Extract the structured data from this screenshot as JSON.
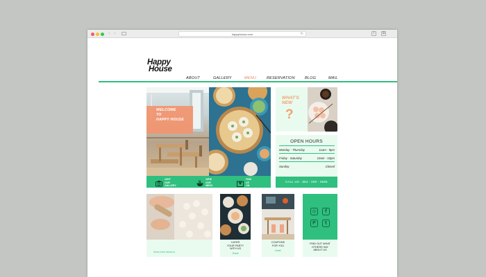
{
  "browser": {
    "url": "happyhouse.com",
    "back_icon": "back-arrow-icon",
    "forward_icon": "forward-arrow-icon",
    "reload_icon": "reload-icon",
    "back_glyph": "‹",
    "forward_glyph": "›",
    "reload_glyph": "↻",
    "share_glyph": "⇧",
    "tabs_glyph": "⧉"
  },
  "site": {
    "logo_line1": "Happy",
    "logo_line2": "House"
  },
  "nav": {
    "items": [
      {
        "label": "ABOUT"
      },
      {
        "label": "GALLERY"
      },
      {
        "label": "MENU",
        "active": true
      },
      {
        "label": "RESERVATION"
      },
      {
        "label": "BLOG"
      },
      {
        "label": "MAIL"
      }
    ]
  },
  "hero": {
    "welcome_line1": "WELCOME",
    "welcome_line2": "TO",
    "welcome_line3": "HAPPY HOUSE",
    "actions": [
      {
        "label": "VISIT OUR\nGALLERY",
        "icon": "camera-icon"
      },
      {
        "label": "VIEW OUR\nMENU",
        "icon": "bowl-icon"
      },
      {
        "label": "FIND US ON\nTHE MAP",
        "icon": "map-pin-icon"
      }
    ]
  },
  "news": {
    "title_line1": "WHAT'S",
    "title_line2": "NEW",
    "mark": "?"
  },
  "hours": {
    "title": "OPEN HOURS",
    "rows": [
      {
        "days": "Monday - Thursday",
        "time": "11am - 9pm"
      },
      {
        "days": "Friday - Saturday",
        "time": "10am - 10pm"
      },
      {
        "days": "Sunday",
        "time": "Closed"
      }
    ],
    "call": "CALL US : 954 - 000 - 5555"
  },
  "cards": {
    "about": {
      "link": "Know more about us"
    },
    "cater": {
      "text": "CATER\nYOUR PARTY\nWITH US",
      "link": "Detail"
    },
    "coupons": {
      "text": "COUPONS\nFOR YOU",
      "link": "Detail"
    },
    "social": {
      "text": "FIND OUT WHAT\nOTHERS SAY\nABOUT US",
      "icons": [
        "instagram-icon",
        "facebook-icon",
        "pinterest-icon",
        "twitter-icon"
      ],
      "glyphs": [
        "◎",
        "f",
        "P",
        "t"
      ]
    }
  },
  "colors": {
    "accent_green": "#2fbf7e",
    "accent_orange": "#f2946e",
    "mint": "#e9fbef"
  }
}
